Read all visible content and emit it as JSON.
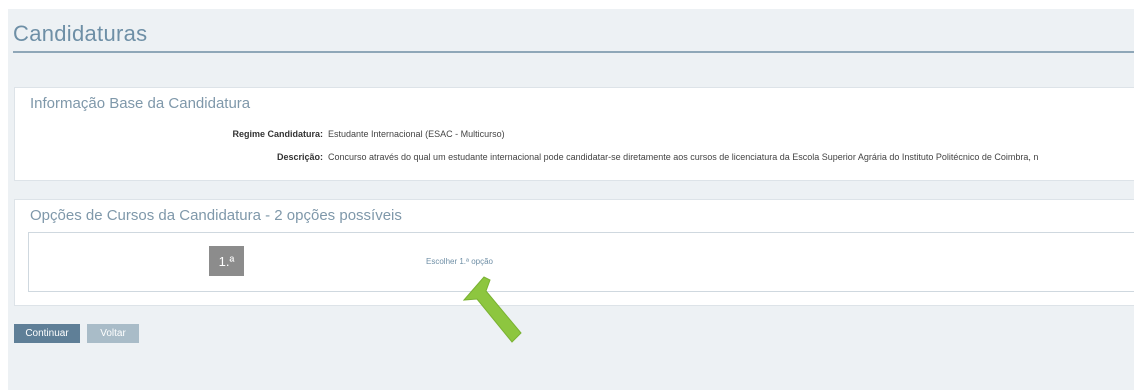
{
  "page": {
    "title": "Candidaturas"
  },
  "info_panel": {
    "title": "Informação Base da Candidatura",
    "fields": [
      {
        "label": "Regime Candidatura:",
        "value": "Estudante Internacional (ESAC - Multicurso)"
      },
      {
        "label": "Descrição:",
        "value": "Concurso através do qual um estudante internacional pode candidatar-se diretamente aos cursos de licenciatura da Escola Superior Agrária do Instituto Politécnico de Coimbra, n"
      }
    ]
  },
  "options_panel": {
    "title": "Opções de Cursos da Candidatura - 2 opções possíveis",
    "option": {
      "badge": "1.ª",
      "link_text": "Escolher 1.ª opção"
    }
  },
  "buttons": {
    "continue": "Continuar",
    "back": "Voltar"
  },
  "colors": {
    "arrow": "#8dc63f",
    "primary_button": "#5f7f97",
    "secondary_button": "#a9bcc8"
  },
  "icons": {
    "pointer": "green-arrow-icon"
  }
}
